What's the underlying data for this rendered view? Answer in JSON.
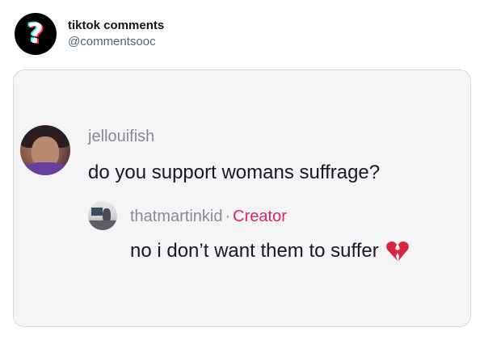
{
  "header": {
    "display_name": "tiktok comments",
    "handle": "@commentsooc",
    "avatar_icon": "question-mark-icon"
  },
  "comment": {
    "username": "jellouifish",
    "text": "do you support womans suffrage?"
  },
  "reply": {
    "username": "thatmartinkid",
    "separator": "·",
    "badge": "Creator",
    "text": "no i don’t want them to suffer",
    "emoji_icon": "broken-heart-icon"
  },
  "colors": {
    "creator_badge": "#e0245e",
    "card_background": "#f5f4f6",
    "muted_text": "#8a8b91"
  }
}
